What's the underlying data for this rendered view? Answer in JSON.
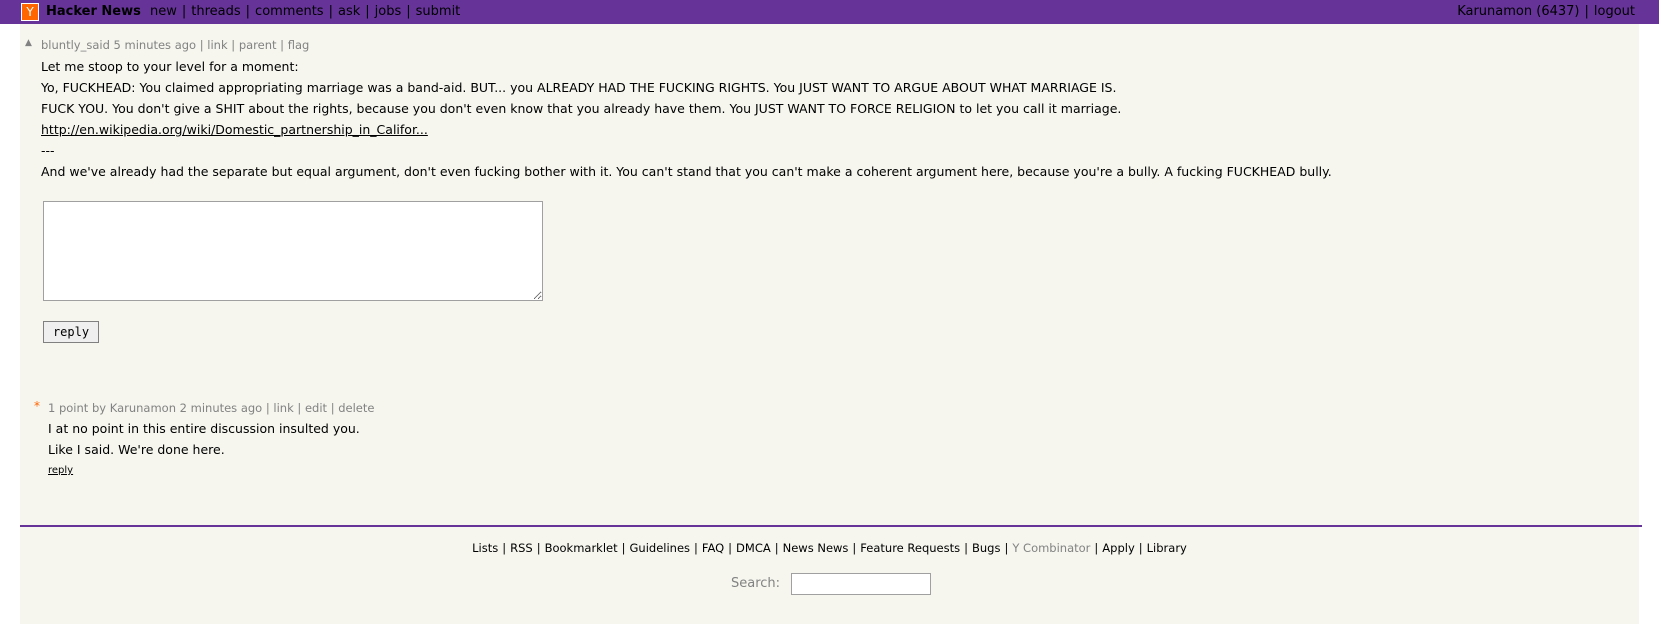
{
  "header": {
    "logo_letter": "Y",
    "site_name": "Hacker News",
    "nav": [
      "new",
      "threads",
      "comments",
      "ask",
      "jobs",
      "submit"
    ],
    "user": "Karunamon",
    "karma": "(6437)",
    "logout": "logout"
  },
  "comment1": {
    "author": "bluntly_said",
    "age": "5 minutes ago",
    "links": [
      "link",
      "parent",
      "flag"
    ],
    "lines": [
      "Let me stoop to your level for a moment:",
      "Yo, FUCKHEAD: You claimed appropriating marriage was a band-aid. BUT... you ALREADY HAD THE FUCKING RIGHTS. You JUST WANT TO ARGUE ABOUT WHAT MARRIAGE IS.",
      "FUCK YOU. You don't give a SHIT about the rights, because you don't even know that you already have them. You JUST WANT TO FORCE RELIGION to let you call it marriage.",
      "---",
      "And we've already had the separate but equal argument, don't even fucking bother with it. You can't stand that you can't make a coherent argument here, because you're a bully. A fucking FUCKHEAD bully."
    ],
    "url": "http://en.wikipedia.org/wiki/Domestic_partnership_in_Califor..."
  },
  "reply_form": {
    "button_label": "reply"
  },
  "comment2": {
    "star": "*",
    "points": "1 point",
    "by": "by",
    "author": "Karunamon",
    "age": "2 minutes ago",
    "links": [
      "link",
      "edit",
      "delete"
    ],
    "lines": [
      "I at no point in this entire discussion insulted you.",
      "Like I said. We're done here."
    ],
    "reply": "reply"
  },
  "footer": {
    "links": [
      "Lists",
      "RSS",
      "Bookmarklet",
      "Guidelines",
      "FAQ",
      "DMCA",
      "News News",
      "Feature Requests",
      "Bugs",
      "Y Combinator",
      "Apply",
      "Library"
    ],
    "search_label": "Search:"
  },
  "colors": {
    "topbar": "#663399",
    "background": "#f6f6ef",
    "logo": "#ff6600",
    "meta_text": "#828282"
  }
}
